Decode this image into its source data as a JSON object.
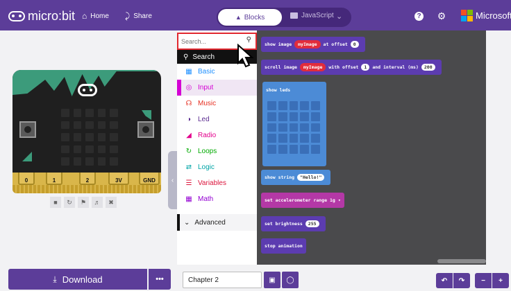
{
  "header": {
    "brand": "micro:bit",
    "home_label": "Home",
    "share_label": "Share",
    "blocks_label": "Blocks",
    "javascript_label": "JavaScript",
    "help_icon": "?",
    "microsoft_label": "Microsoft"
  },
  "simulator": {
    "pins": [
      "0",
      "1",
      "2",
      "3V",
      "GND"
    ],
    "controls": [
      "stop-icon",
      "restart-icon",
      "debug-icon",
      "mute-icon",
      "fullscreen-icon"
    ]
  },
  "toolbox": {
    "search_placeholder": "Search...",
    "search_item_label": "Search",
    "categories": [
      {
        "label": "Basic",
        "color": "#1e90ff"
      },
      {
        "label": "Input",
        "color": "#d400d4"
      },
      {
        "label": "Music",
        "color": "#e63022"
      },
      {
        "label": "Led",
        "color": "#5c2d91"
      },
      {
        "label": "Radio",
        "color": "#e3008c"
      },
      {
        "label": "Loops",
        "color": "#00aa00"
      },
      {
        "label": "Logic",
        "color": "#00a4a6"
      },
      {
        "label": "Variables",
        "color": "#dc143c"
      },
      {
        "label": "Math",
        "color": "#9400d3"
      }
    ],
    "advanced_label": "Advanced"
  },
  "workspace": {
    "block1": {
      "pre": "show image",
      "var": "myImage",
      "post": "at offset",
      "value": "0"
    },
    "block2": {
      "pre": "scroll image",
      "var": "myImage",
      "mid": "with offset",
      "offset": "1",
      "post": "and interval (ms)",
      "interval": "200"
    },
    "block3": {
      "title": "show leds"
    },
    "block4": {
      "pre": "show string",
      "value": "\"Hello!\""
    },
    "block5": {
      "pre": "set accelerometer range",
      "value": "1g"
    },
    "block6": {
      "pre": "set brightness",
      "value": "255"
    },
    "block7": {
      "label": "stop animation"
    }
  },
  "footer": {
    "download_label": "Download",
    "more_label": "•••",
    "project_name": "Chapter 2"
  }
}
